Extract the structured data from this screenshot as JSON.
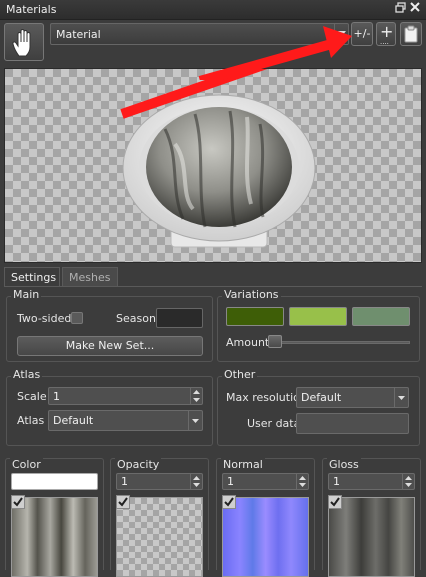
{
  "window": {
    "title": "Materials"
  },
  "toolbar": {
    "material_name": "Material",
    "plus_minus_label": "+/-",
    "add_label": "+",
    "add_dots": "...."
  },
  "tabs": {
    "settings": "Settings",
    "meshes": "Meshes"
  },
  "main": {
    "title": "Main",
    "two_sided_label": "Two-sided",
    "season_label": "Season",
    "make_new_set_label": "Make New Set..."
  },
  "variations": {
    "title": "Variations",
    "colors": [
      "#3e5e07",
      "#98c04a",
      "#6f8f6e"
    ],
    "amount_label": "Amount",
    "amount_value": 0
  },
  "atlas": {
    "title": "Atlas",
    "scale_label": "Scale",
    "scale_value": "1",
    "atlas_label": "Atlas",
    "atlas_value": "Default"
  },
  "other": {
    "title": "Other",
    "max_resolution_label": "Max resolution",
    "max_resolution_value": "Default",
    "user_data_label": "User data",
    "user_data_value": ""
  },
  "slots": [
    {
      "label": "Color",
      "value": ""
    },
    {
      "label": "Opacity",
      "value": "1"
    },
    {
      "label": "Normal",
      "value": "1"
    },
    {
      "label": "Gloss",
      "value": "1"
    }
  ],
  "colors": {
    "arrow": "#ff1a1a",
    "bg": "#3c3c3c"
  }
}
